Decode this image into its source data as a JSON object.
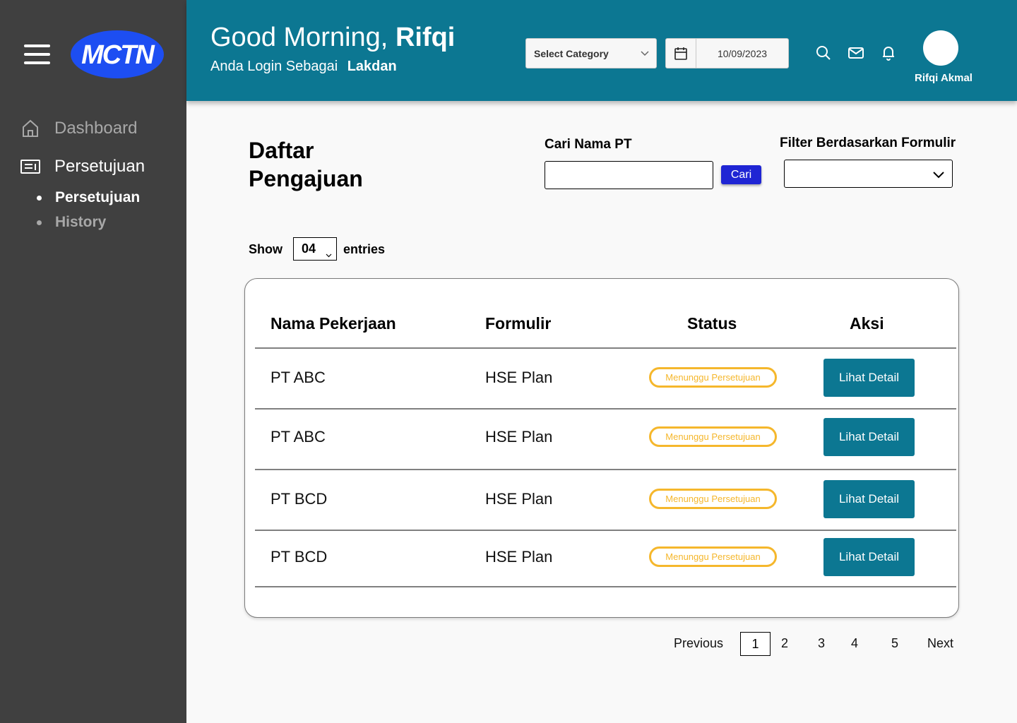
{
  "sidebar": {
    "logo_text": "MCTN",
    "items": [
      {
        "label": "Dashboard",
        "icon": "home-icon"
      },
      {
        "label": "Persetujuan",
        "icon": "list-icon"
      }
    ],
    "subitems": [
      {
        "label": "Persetujuan"
      },
      {
        "label": "History"
      }
    ]
  },
  "header": {
    "greeting_prefix": "Good Morning,",
    "greeting_name": "Rifqi",
    "login_prefix": "Anda Login Sebagai",
    "login_role": "Lakdan",
    "category_placeholder": "Select Category",
    "date": "10/09/2023",
    "user_name": "Rifqi Akmal"
  },
  "main": {
    "title": "Daftar Pengajuan",
    "search_label": "Cari Nama PT",
    "search_value": "",
    "search_button": "Cari",
    "filter_label": "Filter Berdasarkan Formulir",
    "filter_value": "",
    "show_label": "Show",
    "entries_value": "04",
    "entries_label": "entries"
  },
  "table": {
    "headers": [
      "Nama Pekerjaan",
      "Formulir",
      "Status",
      "Aksi"
    ],
    "rows": [
      {
        "name": "PT ABC",
        "form": "HSE Plan",
        "status": "Menunggu Persetujuan",
        "action": "Lihat Detail"
      },
      {
        "name": "PT ABC",
        "form": "HSE Plan",
        "status": "Menunggu Persetujuan",
        "action": "Lihat Detail"
      },
      {
        "name": "PT BCD",
        "form": "HSE Plan",
        "status": "Menunggu Persetujuan",
        "action": "Lihat Detail"
      },
      {
        "name": "PT BCD",
        "form": "HSE Plan",
        "status": "Menunggu Persetujuan",
        "action": "Lihat Detail"
      }
    ]
  },
  "pagination": {
    "previous": "Previous",
    "current": "1",
    "pages": [
      "2",
      "3",
      "4",
      "5"
    ],
    "next": "Next"
  },
  "colors": {
    "header_bg": "#0c7792",
    "sidebar_bg": "#404040",
    "status_badge": "#f5b72c",
    "search_button": "#1f25d4",
    "logo_bg": "#1d4ef2"
  }
}
